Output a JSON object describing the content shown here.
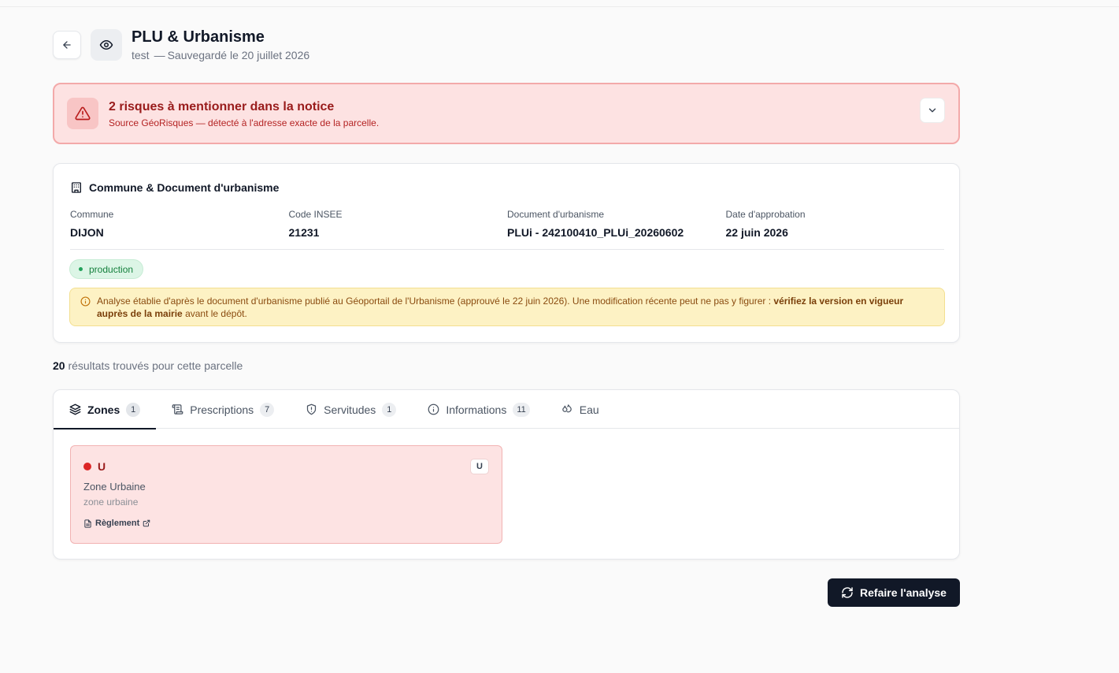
{
  "header": {
    "title": "PLU & Urbanisme",
    "project": "test",
    "separator": "—",
    "saved": "Sauvegardé le 20 juillet 2026"
  },
  "alert": {
    "title": "2 risques à mentionner dans la notice",
    "subtitle": "Source GéoRisques — détecté à l'adresse exacte de la parcelle."
  },
  "commune": {
    "title": "Commune & Document d'urbanisme",
    "fields": [
      {
        "label": "Commune",
        "value": "DIJON"
      },
      {
        "label": "Code INSEE",
        "value": "21231"
      },
      {
        "label": "Document d'urbanisme",
        "value": "PLUi - 242100410_PLUi_20260602"
      },
      {
        "label": "Date d'approbation",
        "value": "22 juin 2026"
      }
    ],
    "status_badge": "production",
    "notice": {
      "text_before": "Analyse établie d'après le document d'urbanisme publié au Géoportail de l'Urbanisme (approuvé le 22 juin 2026). Une modification récente peut ne pas y figurer : ",
      "text_bold": "vérifiez la version en vigueur auprès de la mairie",
      "text_after": " avant le dépôt."
    }
  },
  "results": {
    "count": "20",
    "label": "résultats trouvés pour cette parcelle"
  },
  "tabs": [
    {
      "label": "Zones",
      "count": "1",
      "icon": "layers-icon"
    },
    {
      "label": "Prescriptions",
      "count": "7",
      "icon": "scroll-icon"
    },
    {
      "label": "Servitudes",
      "count": "1",
      "icon": "shield-icon"
    },
    {
      "label": "Informations",
      "count": "11",
      "icon": "info-icon"
    },
    {
      "label": "Eau",
      "count": "",
      "icon": "droplets-icon"
    }
  ],
  "zone": {
    "code": "U",
    "tag": "U",
    "name": "Zone Urbaine",
    "type": "zone urbaine",
    "link_label": "Règlement"
  },
  "actions": {
    "redo_label": "Refaire l'analyse"
  },
  "colors": {
    "danger": "#991b1b",
    "danger_bg": "#fde2e2",
    "success": "#15803d",
    "warning_bg": "#fdf2c4",
    "primary_dark": "#111827"
  }
}
